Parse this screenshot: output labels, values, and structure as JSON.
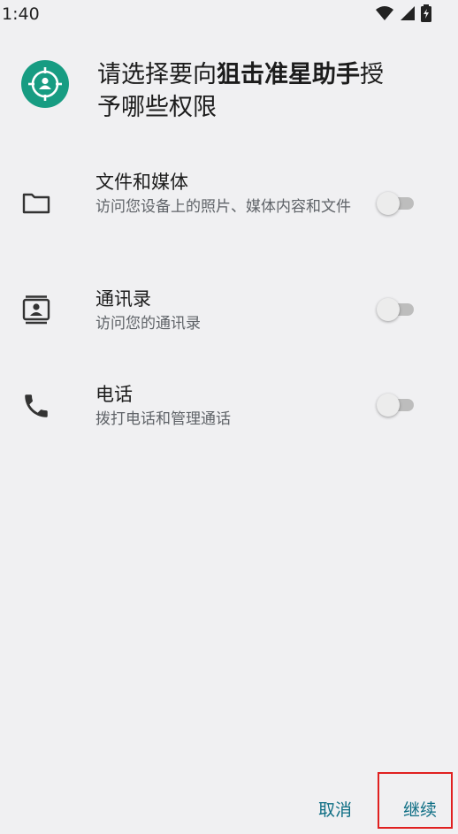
{
  "status_bar": {
    "time": "1:40",
    "icons": [
      "wifi-icon",
      "signal-icon",
      "battery-charging-icon"
    ]
  },
  "dialog": {
    "app_icon": "crosshair-person-icon",
    "app_icon_color": "#179c82",
    "title_prefix": "请选择要向",
    "app_name": "狙击准星助手",
    "title_suffix_1": "授",
    "title_suffix_2": "予哪些权限",
    "permissions": [
      {
        "icon": "folder-icon",
        "title": "文件和媒体",
        "subtitle": "访问您设备上的照片、媒体内容和文件",
        "enabled": false
      },
      {
        "icon": "contacts-icon",
        "title": "通讯录",
        "subtitle": "访问您的通讯录",
        "enabled": false
      },
      {
        "icon": "phone-icon",
        "title": "电话",
        "subtitle": "拨打电话和管理通话",
        "enabled": false
      }
    ],
    "cancel_label": "取消",
    "continue_label": "继续",
    "accent_color": "#0e6e84"
  }
}
